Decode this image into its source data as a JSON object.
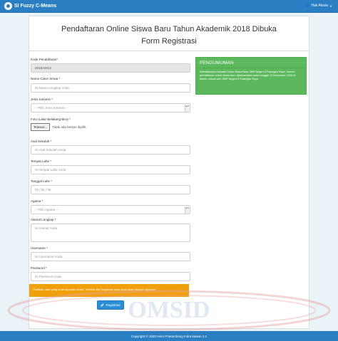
{
  "navbar": {
    "brand": "SI Fuzzy C-Means",
    "user_menu": "Hak Akses",
    "brand_color": "#2a7fc2"
  },
  "page": {
    "title": "Pendaftaran Online Siswa Baru Tahun Akademik 2018 Dibuka",
    "subtitle": "Form Registrasi"
  },
  "form": {
    "kode_label": "Kode Pendaftaran*",
    "kode_value": "2018A0012",
    "nama_label": "Nama Calon Siswa *",
    "nama_placeholder": "Isi Nama Lengkap Anda",
    "jk_label": "Jenis Kelamin *",
    "jk_selected": "-- Pilih Jenis Kelamin --",
    "foto_label": "Foto (Latar Belakang Biru) *",
    "foto_button": "Telusuri...",
    "foto_status": "Tidak ada berkas dipilih.",
    "sekolah_label": "Asal Sekolah *",
    "sekolah_placeholder": "Isi Asal Sekolah Anda",
    "tempat_label": "Tempat Lahir *",
    "tempat_placeholder": "Isi Tempat Lahir Anda",
    "tanggal_label": "Tanggal Lahir *",
    "tanggal_placeholder": "hh / bb / tttt",
    "agama_label": "Agama *",
    "agama_selected": "-- Pilih Agama --",
    "alamat_label": "Alamat Lengkap *",
    "alamat_placeholder": "Isi Alamat Anda",
    "username_label": "Username *",
    "username_placeholder": "Isi Username Anda",
    "password_label": "Password *",
    "password_placeholder": "Isi Password Anda",
    "notice": "Pastikan data yang anda inputkan benar. Setelah klik Registrasi data anda akan dirubah diproses",
    "submit_label": "Registrasi"
  },
  "announcement": {
    "heading": "PENGUMUMAN",
    "body": "Diberitahukan kepada Calon Siswa Baru SMP Negeri 8 Palangka Raya, bahwa pendaftaran online siswa baru dilaksanakan pada tanggal 14 November 2018 di kantor vokasi web SMP Negeri 8 Palangka Raya",
    "color": "#5cb85c"
  },
  "watermark": "OMSID",
  "footer": "Copyright © 2020 Hero Prakambang Indra kawan 3.1"
}
